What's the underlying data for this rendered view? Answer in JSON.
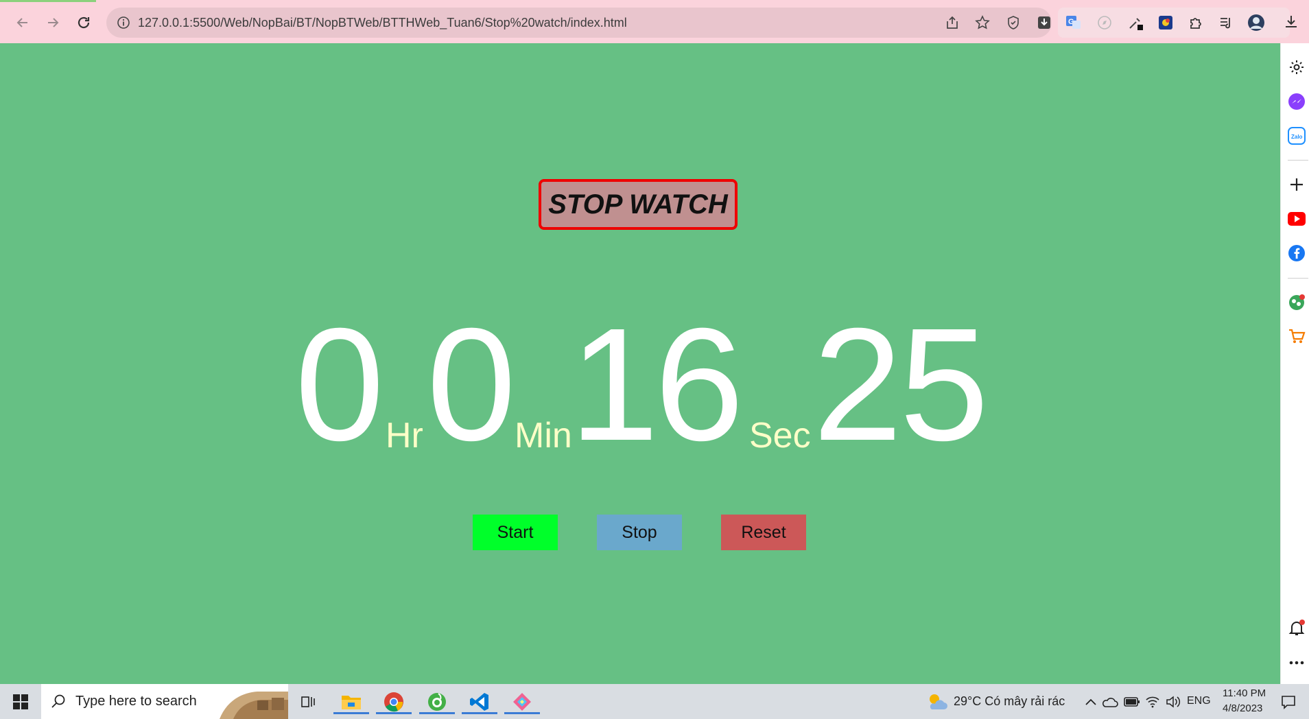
{
  "browser": {
    "url": "127.0.0.1:5500/Web/NopBai/BT/NopBTWeb/BTTHWeb_Tuan6/Stop%20watch/index.html"
  },
  "page": {
    "title": "STOP WATCH",
    "hours": "0",
    "hours_unit": "Hr",
    "minutes": "0",
    "minutes_unit": "Min",
    "seconds": "16",
    "seconds_unit": "Sec",
    "centiseconds": "25",
    "buttons": {
      "start": "Start",
      "stop": "Stop",
      "reset": "Reset"
    },
    "colors": {
      "background": "#66c084",
      "start": "#00ff2a",
      "stop": "#6aa8cc",
      "reset": "#cc5858",
      "title_border": "#ee0000",
      "title_bg": "#c09090"
    }
  },
  "taskbar": {
    "search_placeholder": "Type here to search",
    "weather": "29°C  Có mây rải rác",
    "language": "ENG",
    "time": "11:40 PM",
    "date": "4/8/2023"
  }
}
